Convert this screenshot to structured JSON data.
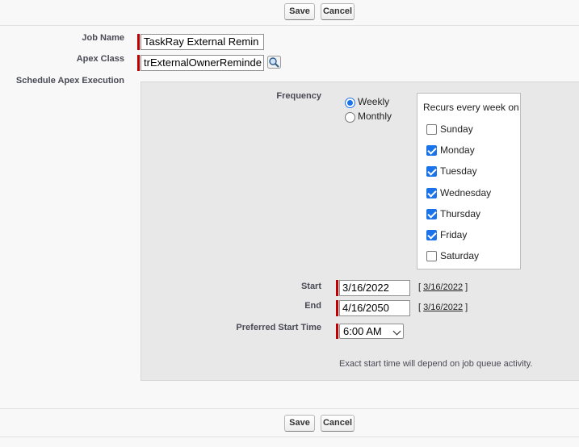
{
  "top_buttons": {
    "save_label": "Save",
    "cancel_label": "Cancel"
  },
  "bottom_buttons": {
    "save_label": "Save",
    "cancel_label": "Cancel"
  },
  "form": {
    "job_name": {
      "label": "Job Name",
      "value": "TaskRay External Remin"
    },
    "apex_class": {
      "label": "Apex Class",
      "value": "trExternalOwnerReminde",
      "lookup_icon": "magnifier-lookup-icon"
    },
    "schedule_label": "Schedule Apex Execution"
  },
  "schedule": {
    "frequency_label": "Frequency",
    "frequency_options": [
      {
        "label": "Weekly",
        "checked": true
      },
      {
        "label": "Monthly",
        "checked": false
      }
    ],
    "recurs_title": "Recurs every week on",
    "days": [
      {
        "label": "Sunday",
        "checked": false
      },
      {
        "label": "Monday",
        "checked": true
      },
      {
        "label": "Tuesday",
        "checked": true
      },
      {
        "label": "Wednesday",
        "checked": true
      },
      {
        "label": "Thursday",
        "checked": true
      },
      {
        "label": "Friday",
        "checked": true
      },
      {
        "label": "Saturday",
        "checked": false
      }
    ],
    "start": {
      "label": "Start",
      "value": "3/16/2022",
      "today_link": "3/16/2022"
    },
    "end": {
      "label": "End",
      "value": "4/16/2050",
      "today_link": "3/16/2022"
    },
    "preferred_start_time": {
      "label": "Preferred Start Time",
      "value": "6:00 AM"
    },
    "note": "Exact start time will depend on job queue activity."
  },
  "colors": {
    "required_bar": "#c00000",
    "accent": "#1a73e8",
    "panel_bg": "#e8e8e8",
    "page_bg": "#f8f8f8"
  }
}
